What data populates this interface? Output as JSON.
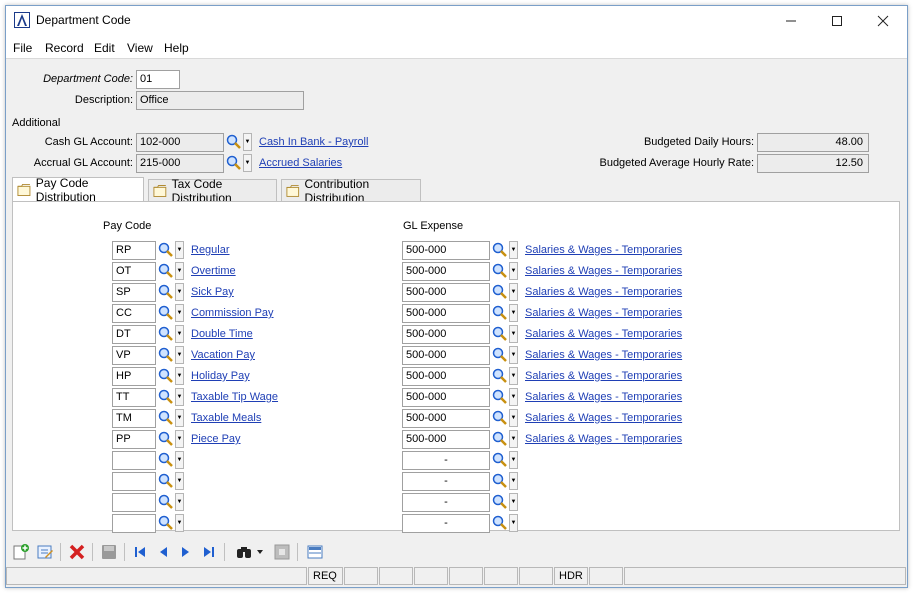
{
  "window": {
    "title": "Department Code"
  },
  "menu": [
    "File",
    "Record",
    "Edit",
    "View",
    "Help"
  ],
  "header": {
    "dept_code_label": "Department Code:",
    "dept_code_value": "01",
    "description_label": "Description:",
    "description_value": "Office"
  },
  "additional": {
    "section_label": "Additional",
    "cash_label": "Cash GL Account:",
    "cash_value": "102-000",
    "cash_link": "Cash In Bank - Payroll",
    "accrual_label": "Accrual GL Account:",
    "accrual_value": "215-000",
    "accrual_link": "Accrued Salaries",
    "daily_hours_label": "Budgeted Daily Hours:",
    "daily_hours_value": "48.00",
    "avg_rate_label": "Budgeted Average Hourly Rate:",
    "avg_rate_value": "12.50"
  },
  "tabs": [
    "Pay Code Distribution",
    "Tax Code Distribution",
    "Contribution Distribution"
  ],
  "grid": {
    "pay_code_header": "Pay Code",
    "gl_expense_header": "GL Expense",
    "rows": [
      {
        "code": "RP",
        "name": "Regular",
        "gl": "500-000",
        "gl_name": "Salaries & Wages - Temporaries"
      },
      {
        "code": "OT",
        "name": "Overtime",
        "gl": "500-000",
        "gl_name": "Salaries & Wages - Temporaries"
      },
      {
        "code": "SP",
        "name": "Sick Pay",
        "gl": "500-000",
        "gl_name": "Salaries & Wages - Temporaries"
      },
      {
        "code": "CC",
        "name": "Commission Pay",
        "gl": "500-000",
        "gl_name": "Salaries & Wages - Temporaries"
      },
      {
        "code": "DT",
        "name": "Double Time",
        "gl": "500-000",
        "gl_name": "Salaries & Wages - Temporaries"
      },
      {
        "code": "VP",
        "name": "Vacation Pay",
        "gl": "500-000",
        "gl_name": "Salaries & Wages - Temporaries"
      },
      {
        "code": "HP",
        "name": "Holiday Pay",
        "gl": "500-000",
        "gl_name": "Salaries & Wages - Temporaries"
      },
      {
        "code": "TT",
        "name": "Taxable Tip Wage",
        "gl": "500-000",
        "gl_name": "Salaries & Wages - Temporaries"
      },
      {
        "code": "TM",
        "name": "Taxable Meals",
        "gl": "500-000",
        "gl_name": "Salaries & Wages - Temporaries"
      },
      {
        "code": "PP",
        "name": "Piece Pay",
        "gl": "500-000",
        "gl_name": "Salaries & Wages - Temporaries"
      },
      {
        "code": "",
        "name": "",
        "gl": "-",
        "gl_name": ""
      },
      {
        "code": "",
        "name": "",
        "gl": "-",
        "gl_name": ""
      },
      {
        "code": "",
        "name": "",
        "gl": "-",
        "gl_name": ""
      },
      {
        "code": "",
        "name": "",
        "gl": "-",
        "gl_name": ""
      }
    ]
  },
  "toolbar": [
    "new-record-icon",
    "edit-record-icon",
    "delete-icon",
    "save-icon",
    "first-record-icon",
    "previous-record-icon",
    "next-record-icon",
    "last-record-icon",
    "find-icon",
    "find-dropdown-icon",
    "filter-icon",
    "layout-icon"
  ],
  "status": {
    "req": "REQ",
    "hdr": "HDR"
  },
  "colors": {
    "link": "#1f3fb5",
    "delete": "#d42020",
    "nav": "#1f5fd0"
  }
}
